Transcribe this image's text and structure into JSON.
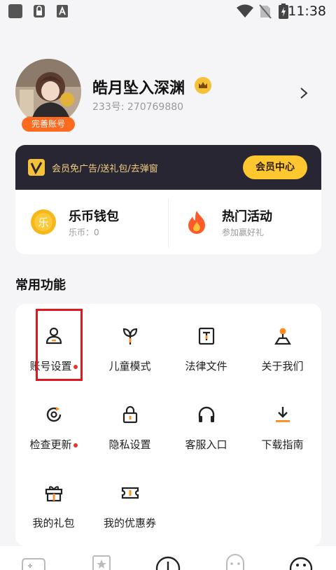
{
  "status_bar": {
    "time": "11:38",
    "icons": [
      "app-square-icon",
      "lock-screen-icon",
      "font-a-icon",
      "wifi-icon",
      "no-sim-icon",
      "battery-icon"
    ]
  },
  "profile": {
    "avatar_badge": "完善账号",
    "username": "皓月坠入深渊",
    "uid": "233号: 270769880"
  },
  "vip": {
    "promo": "会员免广告/送礼包/去弹窗",
    "button": "会员中心",
    "items": [
      {
        "title": "乐币钱包",
        "subtitle": "乐币：0",
        "icon": "le-coin-icon",
        "icon_char": "乐"
      },
      {
        "title": "热门活动",
        "subtitle": "参加赢好礼",
        "icon": "fire-icon"
      }
    ]
  },
  "functions": {
    "title": "常用功能",
    "items": [
      {
        "label": "账号设置",
        "icon": "user-icon",
        "dot": true
      },
      {
        "label": "儿童模式",
        "icon": "sprout-icon",
        "dot": false
      },
      {
        "label": "法律文件",
        "icon": "document-icon",
        "dot": false
      },
      {
        "label": "关于我们",
        "icon": "location-pin-icon",
        "dot": false
      },
      {
        "label": "检查更新",
        "icon": "refresh-icon",
        "dot": true
      },
      {
        "label": "隐私设置",
        "icon": "lock-icon",
        "dot": false
      },
      {
        "label": "客服入口",
        "icon": "headphones-icon",
        "dot": false
      },
      {
        "label": "下载指南",
        "icon": "download-icon",
        "dot": false
      },
      {
        "label": "我的礼包",
        "icon": "gift-icon",
        "dot": false
      },
      {
        "label": "我的优惠券",
        "icon": "coupon-icon",
        "dot": false
      }
    ]
  },
  "tab_bar": {
    "icons": [
      "gamepad-icon",
      "star-card-icon",
      "center-circle-icon",
      "ghost-icon",
      "face-icon"
    ]
  },
  "colors": {
    "accent_orange": "#ff6a1f",
    "vip_dark": "#282633",
    "vip_gold": "#ffc72f",
    "highlight_red": "#e0171e"
  }
}
